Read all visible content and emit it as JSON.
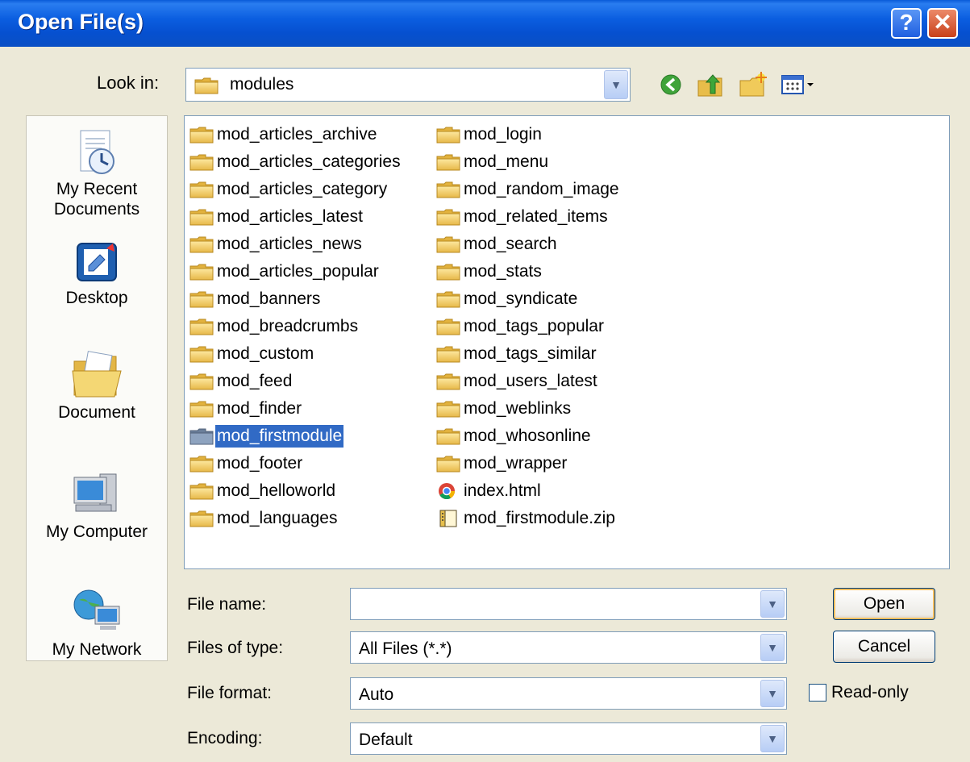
{
  "window": {
    "title": "Open File(s)",
    "help_label": "?",
    "close_label": "✕"
  },
  "lookin": {
    "label": "Look in:",
    "value": "modules"
  },
  "nav_icons": [
    "back-icon",
    "up-folder-icon",
    "new-folder-icon",
    "view-menu-icon"
  ],
  "places": [
    {
      "name": "my-recent-documents",
      "icon": "recent-documents-icon",
      "label": "My Recent\nDocuments"
    },
    {
      "name": "desktop",
      "icon": "desktop-icon",
      "label": "Desktop"
    },
    {
      "name": "document",
      "icon": "documents-icon",
      "label": "Document"
    },
    {
      "name": "my-computer",
      "icon": "computer-icon",
      "label": "My Computer"
    },
    {
      "name": "my-network",
      "icon": "network-icon",
      "label": "My Network"
    }
  ],
  "files": {
    "column1": [
      {
        "label": "mod_articles_archive",
        "type": "folder"
      },
      {
        "label": "mod_articles_categories",
        "type": "folder"
      },
      {
        "label": "mod_articles_category",
        "type": "folder"
      },
      {
        "label": "mod_articles_latest",
        "type": "folder"
      },
      {
        "label": "mod_articles_news",
        "type": "folder"
      },
      {
        "label": "mod_articles_popular",
        "type": "folder"
      },
      {
        "label": "mod_banners",
        "type": "folder"
      },
      {
        "label": "mod_breadcrumbs",
        "type": "folder"
      },
      {
        "label": "mod_custom",
        "type": "folder"
      },
      {
        "label": "mod_feed",
        "type": "folder"
      },
      {
        "label": "mod_finder",
        "type": "folder"
      },
      {
        "label": "mod_firstmodule",
        "type": "folder",
        "selected": true
      },
      {
        "label": "mod_footer",
        "type": "folder"
      },
      {
        "label": "mod_helloworld",
        "type": "folder"
      },
      {
        "label": "mod_languages",
        "type": "folder"
      }
    ],
    "column2": [
      {
        "label": "mod_login",
        "type": "folder"
      },
      {
        "label": "mod_menu",
        "type": "folder"
      },
      {
        "label": "mod_random_image",
        "type": "folder"
      },
      {
        "label": "mod_related_items",
        "type": "folder"
      },
      {
        "label": "mod_search",
        "type": "folder"
      },
      {
        "label": "mod_stats",
        "type": "folder"
      },
      {
        "label": "mod_syndicate",
        "type": "folder"
      },
      {
        "label": "mod_tags_popular",
        "type": "folder"
      },
      {
        "label": "mod_tags_similar",
        "type": "folder"
      },
      {
        "label": "mod_users_latest",
        "type": "folder"
      },
      {
        "label": "mod_weblinks",
        "type": "folder"
      },
      {
        "label": "mod_whosonline",
        "type": "folder"
      },
      {
        "label": "mod_wrapper",
        "type": "folder"
      },
      {
        "label": "index.html",
        "type": "html"
      },
      {
        "label": "mod_firstmodule.zip",
        "type": "zip"
      }
    ]
  },
  "form": {
    "file_name": {
      "label": "File name:",
      "value": ""
    },
    "files_of_type": {
      "label": "Files of type:",
      "value": "All Files (*.*)"
    },
    "file_format": {
      "label": "File format:",
      "value": "Auto"
    },
    "encoding": {
      "label": "Encoding:",
      "value": "Default"
    }
  },
  "buttons": {
    "open": "Open",
    "cancel": "Cancel"
  },
  "readonly": {
    "label": "Read-only",
    "checked": false
  },
  "colors": {
    "title_blue": "#0a5bd8",
    "selection": "#316ac5",
    "dialog_bg": "#ece9d8"
  }
}
